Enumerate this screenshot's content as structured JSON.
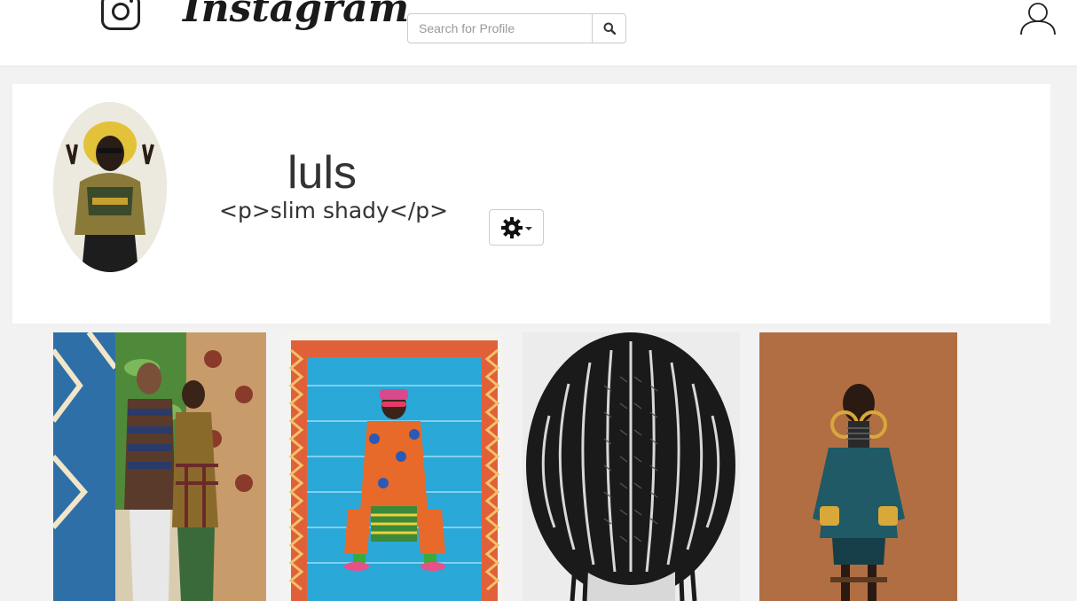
{
  "header": {
    "logo_icon": "instagram-glyph-icon",
    "wordmark": "Instagram",
    "search": {
      "placeholder": "Search for Profile",
      "value": "",
      "button_icon": "search-icon"
    },
    "user_icon": "user-profile-icon"
  },
  "profile": {
    "username": "luls",
    "bio": "<p>slim shady</p>",
    "settings_icon": "gear-icon",
    "settings_caret_icon": "caret-down-icon"
  },
  "posts": [
    {
      "alt": "couple-patterned-wallpaper-photo"
    },
    {
      "alt": "man-in-patterned-suit-photo"
    },
    {
      "alt": "braided-hair-photo"
    },
    {
      "alt": "woman-with-gold-earrings-photo"
    }
  ],
  "colors": {
    "page_bg": "#f2f2f2",
    "card_bg": "#ffffff",
    "text": "#333333",
    "border": "#cccccc"
  }
}
